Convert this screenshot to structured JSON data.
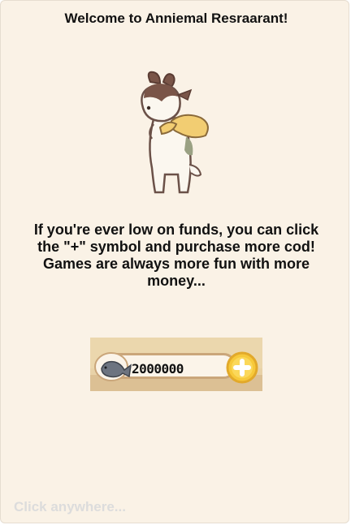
{
  "dialog": {
    "title": "Welcome to Anniemal Resraarant!",
    "message": "If you're ever low on funds, you can click the \"+\" symbol and purchase more cod! Games are always more fun with more money...",
    "hint": "Click anywhere..."
  },
  "currency": {
    "icon": "fish-icon",
    "amount": "2000000",
    "add_icon": "plus-icon"
  },
  "colors": {
    "background": "#faf2e6",
    "plus_button": "#f7c93a",
    "hint_text": "#dcdcdc"
  }
}
